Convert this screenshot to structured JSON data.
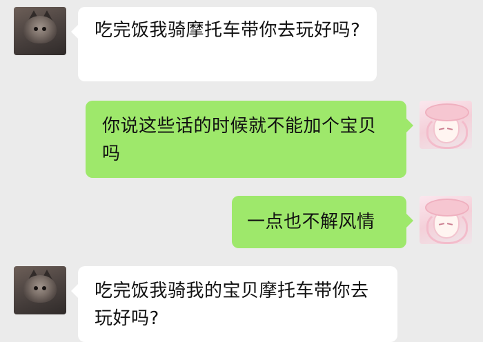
{
  "messages": [
    {
      "side": "left",
      "text": "吃完饭我骑摩托车带你去玩好吗?"
    },
    {
      "side": "right",
      "text": "你说这些话的时候就不能加个宝贝吗"
    },
    {
      "side": "right",
      "text": "一点也不解风情"
    },
    {
      "side": "left",
      "text": "吃完饭我骑我的宝贝摩托车带你去玩好吗?"
    }
  ],
  "colors": {
    "background": "#ebebeb",
    "incoming_bubble": "#ffffff",
    "outgoing_bubble": "#9ee86b",
    "text": "#111111"
  },
  "icons": {
    "left_avatar": "cat-avatar-icon",
    "right_avatar": "anime-girl-avatar-icon"
  }
}
